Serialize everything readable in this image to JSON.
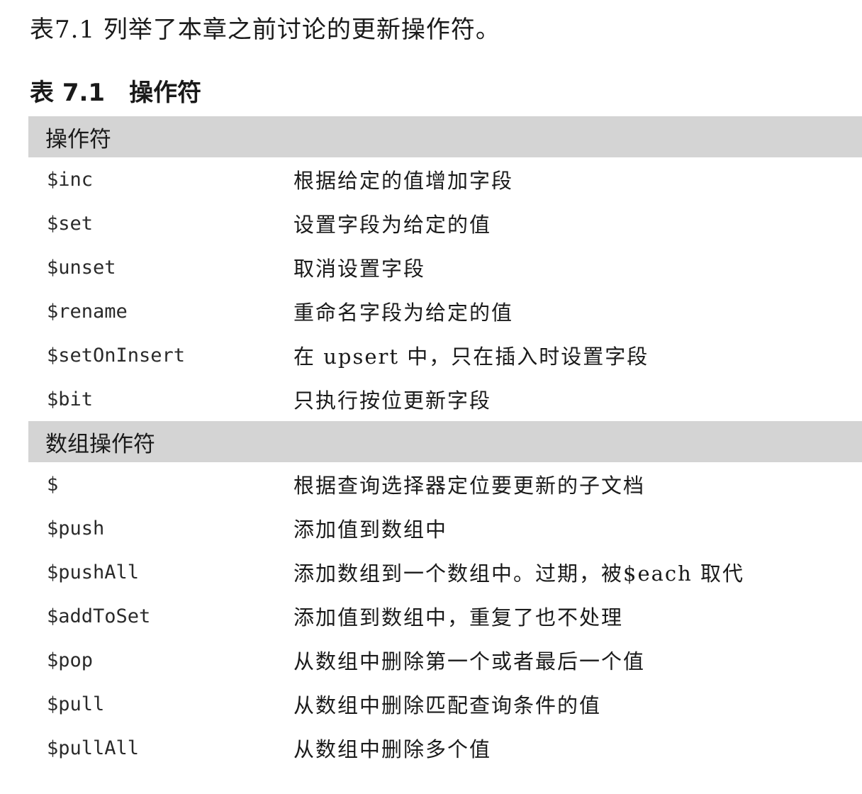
{
  "intro": "表7.1 列举了本章之前讨论的更新操作符。",
  "caption": {
    "number": "表 7.1",
    "title": "操作符"
  },
  "sections": [
    {
      "header": "操作符",
      "rows": [
        {
          "op": "$inc",
          "desc": "根据给定的值增加字段"
        },
        {
          "op": "$set",
          "desc": "设置字段为给定的值"
        },
        {
          "op": "$unset",
          "desc": "取消设置字段"
        },
        {
          "op": "$rename",
          "desc": "重命名字段为给定的值"
        },
        {
          "op": "$setOnInsert",
          "desc": "在 upsert 中，只在插入时设置字段"
        },
        {
          "op": "$bit",
          "desc": "只执行按位更新字段"
        }
      ]
    },
    {
      "header": "数组操作符",
      "rows": [
        {
          "op": "$",
          "desc": "根据查询选择器定位要更新的子文档"
        },
        {
          "op": "$push",
          "desc": "添加值到数组中"
        },
        {
          "op": "$pushAll",
          "desc": "添加数组到一个数组中。过期，被$each 取代"
        },
        {
          "op": "$addToSet",
          "desc": "添加值到数组中，重复了也不处理"
        },
        {
          "op": "$pop",
          "desc": "从数组中删除第一个或者最后一个值"
        },
        {
          "op": "$pull",
          "desc": "从数组中删除匹配查询条件的值"
        },
        {
          "op": "$pullAll",
          "desc": "从数组中删除多个值"
        }
      ]
    }
  ]
}
